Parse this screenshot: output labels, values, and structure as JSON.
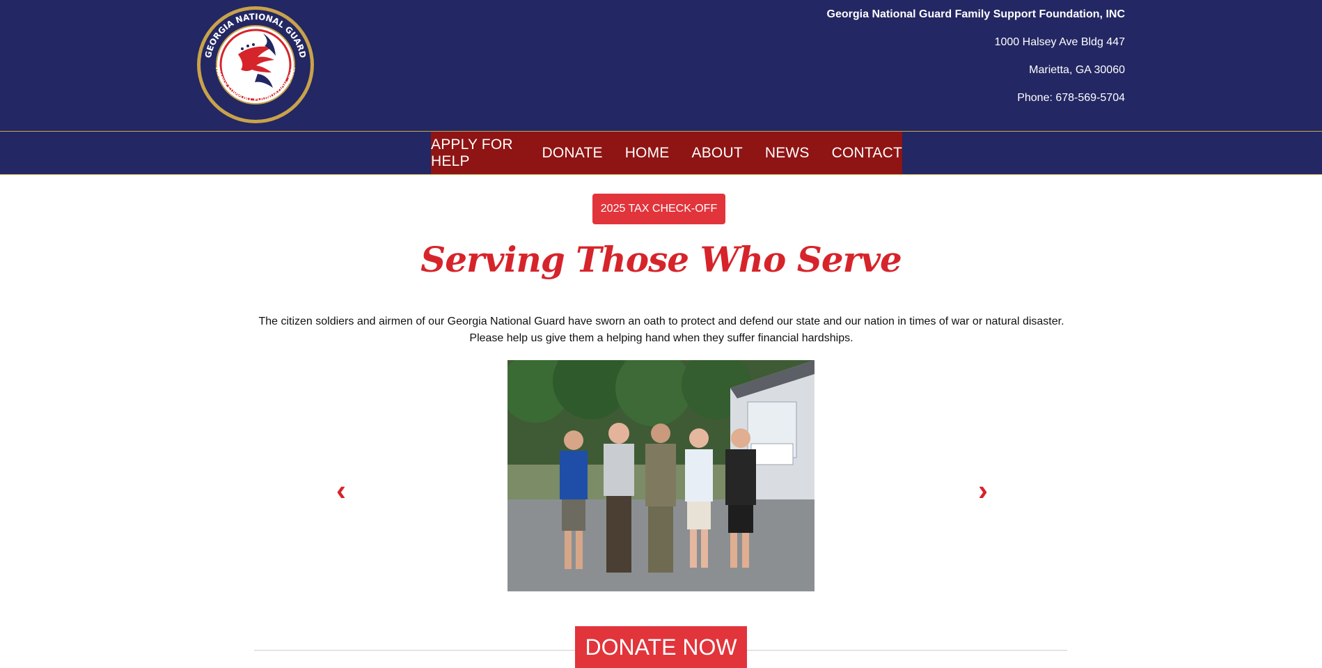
{
  "header": {
    "logo_alt": "Georgia National Guard Family Support Foundation, Inc. logo",
    "logo_top_text": "GEORGIA NATIONAL GUARD",
    "logo_bottom_text": "FAMILY SUPPORT FOUNDATION, INC.",
    "org_name": "Georgia National Guard Family Support Foundation, INC",
    "address_line1": "1000 Halsey Ave Bldg 447",
    "address_line2": "Marietta, GA 30060",
    "phone": "Phone: 678-569-5704"
  },
  "nav": {
    "items": [
      {
        "label": "APPLY FOR HELP"
      },
      {
        "label": "DONATE"
      },
      {
        "label": "HOME"
      },
      {
        "label": "ABOUT"
      },
      {
        "label": "NEWS"
      },
      {
        "label": "CONTACT"
      }
    ]
  },
  "main": {
    "tax_button": "2025 TAX CHECK-OFF",
    "headline": "Serving Those Who Serve",
    "intro_line1": "The citizen soldiers and airmen of our Georgia National Guard have sworn an oath to protect and defend our state and our nation in times of war or natural disaster.",
    "intro_line2": "Please help us give them a helping hand when they suffer financial hardships.",
    "carousel": {
      "prev": "‹",
      "next": "›"
    },
    "donate_now": "DONATE NOW"
  },
  "colors": {
    "header_bg": "#232763",
    "nav_active_bg": "#8f1414",
    "accent_red": "#e2343b",
    "gold": "#c8a94a"
  }
}
